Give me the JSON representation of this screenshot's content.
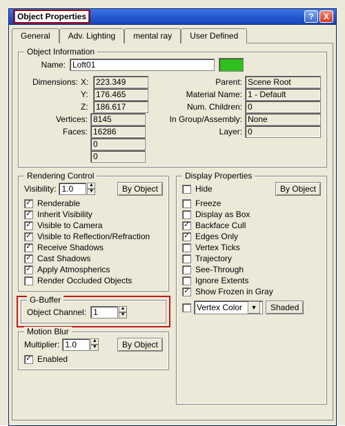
{
  "window": {
    "title": "Object Properties",
    "help_tooltip": "?",
    "close_tooltip": "X"
  },
  "tabs": {
    "items": [
      "General",
      "Adv. Lighting",
      "mental ray",
      "User Defined"
    ],
    "active_index": 0
  },
  "object_info": {
    "group_title": "Object Information",
    "name_label": "Name:",
    "name_value": "Loft01",
    "color": "#2fbf1e",
    "dimensions_label": "Dimensions:",
    "dim_x_label": "X:",
    "dim_x": "223.349",
    "dim_y_label": "Y:",
    "dim_y": "176.465",
    "dim_z_label": "Z:",
    "dim_z": "186.617",
    "vertices_label": "Vertices:",
    "vertices": "8145",
    "faces_label": "Faces:",
    "faces": "16286",
    "extra1": "0",
    "extra2": "0",
    "parent_label": "Parent:",
    "parent": "Scene Root",
    "material_label": "Material Name:",
    "material": "1 - Default",
    "children_label": "Num. Children:",
    "children": "0",
    "group_label": "In Group/Assembly:",
    "group_value": "None",
    "layer_label": "Layer:",
    "layer": "0"
  },
  "rendering": {
    "group_title": "Rendering Control",
    "visibility_label": "Visibility:",
    "visibility_value": "1.0",
    "by_object_label": "By Object",
    "checks": [
      {
        "label": "Renderable",
        "checked": true
      },
      {
        "label": "Inherit Visibility",
        "checked": true
      },
      {
        "label": "Visible to Camera",
        "checked": true
      },
      {
        "label": "Visible to Reflection/Refraction",
        "checked": true
      },
      {
        "label": "Receive Shadows",
        "checked": true
      },
      {
        "label": "Cast Shadows",
        "checked": true
      },
      {
        "label": "Apply Atmospherics",
        "checked": true
      },
      {
        "label": "Render Occluded Objects",
        "checked": false
      }
    ]
  },
  "gbuffer": {
    "group_title": "G-Buffer",
    "channel_label": "Object Channel:",
    "channel_value": "1"
  },
  "motion_blur": {
    "group_title": "Motion Blur",
    "multiplier_label": "Multiplier:",
    "multiplier_value": "1.0",
    "by_object_label": "By Object",
    "enabled_label": "Enabled",
    "enabled_checked": true
  },
  "display": {
    "group_title": "Display Properties",
    "by_object_label": "By Object",
    "checks": [
      {
        "label": "Hide",
        "checked": false
      },
      {
        "label": "Freeze",
        "checked": false
      },
      {
        "label": "Display as Box",
        "checked": false
      },
      {
        "label": "Backface Cull",
        "checked": true
      },
      {
        "label": "Edges Only",
        "checked": true
      },
      {
        "label": "Vertex Ticks",
        "checked": false
      },
      {
        "label": "Trajectory",
        "checked": false
      },
      {
        "label": "See-Through",
        "checked": false
      },
      {
        "label": "Ignore Extents",
        "checked": false
      },
      {
        "label": "Show Frozen in Gray",
        "checked": true
      }
    ],
    "vertex_color_check": false,
    "vertex_color_label": "Vertex Color",
    "shaded_label": "Shaded"
  }
}
